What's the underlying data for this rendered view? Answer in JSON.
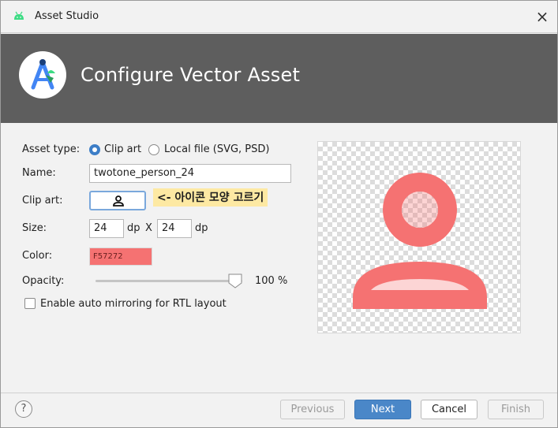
{
  "window": {
    "title": "Asset Studio",
    "close_glyph": "×"
  },
  "banner": {
    "heading": "Configure Vector Asset",
    "logo_icon": "android-studio-logo-icon"
  },
  "form": {
    "asset_type_label": "Asset type:",
    "asset_type_options": [
      "Clip art",
      "Local file (SVG, PSD)"
    ],
    "asset_type_selected": "Clip art",
    "name_label": "Name:",
    "name_value": "twotone_person_24",
    "clip_art_label": "Clip art:",
    "clip_art_icon": "person-icon",
    "annotation": "<- 아이콘 모양 고르기",
    "size_label": "Size:",
    "size_width": "24",
    "size_unit": "dp",
    "size_x": "X",
    "size_height": "24",
    "color_label": "Color:",
    "color_value": "F57272",
    "opacity_label": "Opacity:",
    "opacity_value": "100 %",
    "opacity_level": 1.0,
    "mirroring_label": "Enable auto mirroring for RTL layout",
    "mirroring_checked": false
  },
  "preview": {
    "icon": "person-icon",
    "color": "#f57272"
  },
  "footer": {
    "help": "?",
    "previous": "Previous",
    "next": "Next",
    "cancel": "Cancel",
    "finish": "Finish"
  },
  "colors": {
    "accent": "#4a87c8",
    "banner": "#5e5e5e",
    "icon_color": "#f57272"
  }
}
